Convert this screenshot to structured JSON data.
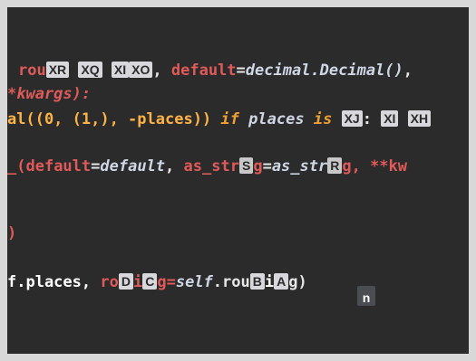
{
  "editor": {
    "line1": {
      "prefix": "rou",
      "hint_xr": "XR",
      "hint_xq": "XQ",
      "hint_xi": "XI",
      "hint_xo": "XO",
      "comma": ",",
      "param": "default",
      "eq": "=",
      "value": "decimal.Decimal()",
      "tail": ","
    },
    "line2": {
      "text": "*kwargs):"
    },
    "line3": {
      "func": "al((0, (1,), -places))",
      "if_kw": "if",
      "places": "places",
      "is_kw": "is",
      "hint_xj": "XJ",
      "colon": ":",
      "hint_x": "XI",
      "hint_xh": "XH"
    },
    "line4": {
      "prefix": "_(",
      "param": "default",
      "eq": "=",
      "value": "default",
      "comma": ",",
      "as_str_a": "as_str",
      "hint_s": "S",
      "gap_a": "g",
      "eq2": "=",
      "as_str_b": "as_str",
      "hint_r": "R",
      "gap_b": "g, **kw"
    },
    "line5": {
      "text": ")"
    },
    "line6": {
      "prefix": "f.places,",
      "ro": "ro",
      "hint_d": "D",
      "hint_c": "C",
      "eq": "g=",
      "self": "self",
      "dot_ro": ".rou",
      "hint_b": "B",
      "hint_a": "A",
      "tail": "g)"
    },
    "caret_hint": "n"
  }
}
